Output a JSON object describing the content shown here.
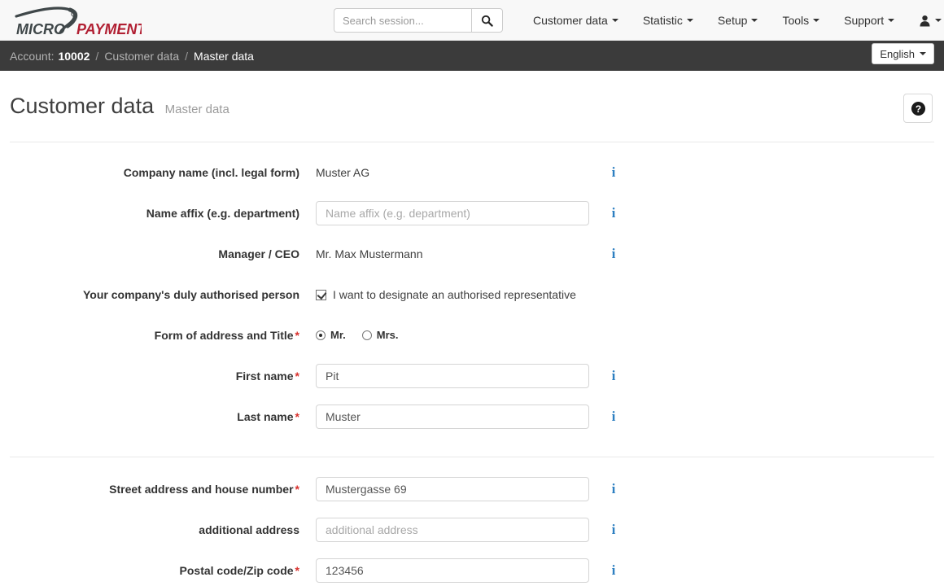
{
  "brand": {
    "word1": "MICRO",
    "word2": "PAYMENT",
    "color1": "#3f4749",
    "color2": "#b12033"
  },
  "search": {
    "placeholder": "Search session...",
    "value": "",
    "icon": "search-icon"
  },
  "nav": {
    "items": [
      {
        "label": "Customer data",
        "caret": true
      },
      {
        "label": "Statistic",
        "caret": true
      },
      {
        "label": "Setup",
        "caret": true
      },
      {
        "label": "Tools",
        "caret": true
      },
      {
        "label": "Support",
        "caret": true
      }
    ],
    "user_menu": {
      "icon": "user-icon",
      "caret": true
    }
  },
  "breadcrumb": {
    "account_label": "Account:",
    "account_number": "10002",
    "sep": "/",
    "item2": "Customer data",
    "item3": "Master data",
    "language": {
      "label": "English",
      "caret": true
    }
  },
  "page": {
    "title": "Customer data",
    "subtitle": "Master data",
    "help_icon": "question-mark-icon"
  },
  "form": {
    "required_marker": "*",
    "info_icon": "info-icon",
    "section1": [
      {
        "label": "Company name (incl. legal form)",
        "type": "static",
        "value": "Muster AG",
        "required": false,
        "info": true
      },
      {
        "label": "Name affix (e.g. department)",
        "type": "input",
        "value": "",
        "placeholder": "Name affix (e.g. department)",
        "required": false,
        "info": true
      },
      {
        "label": "Manager / CEO",
        "type": "static",
        "value": "Mr. Max Mustermann",
        "required": false,
        "info": true
      },
      {
        "label": "Your company's duly authorised person",
        "type": "checkbox",
        "checkbox_label": "I want to designate an authorised representative",
        "checked": true,
        "required": false,
        "info": false
      },
      {
        "label": "Form of address and Title",
        "type": "radio",
        "required": true,
        "options": [
          {
            "label": "Mr.",
            "selected": true
          },
          {
            "label": "Mrs.",
            "selected": false
          }
        ],
        "info": false
      },
      {
        "label": "First name",
        "type": "input",
        "value": "Pit",
        "placeholder": "",
        "required": true,
        "info": true
      },
      {
        "label": "Last name",
        "type": "input",
        "value": "Muster",
        "placeholder": "",
        "required": true,
        "info": true
      }
    ],
    "section2": [
      {
        "label": "Street address and house number",
        "type": "input",
        "value": "Mustergasse 69",
        "placeholder": "",
        "required": true,
        "info": true
      },
      {
        "label": "additional address",
        "type": "input",
        "value": "",
        "placeholder": "additional address",
        "required": false,
        "info": true
      },
      {
        "label": "Postal code/Zip code",
        "type": "input",
        "value": "123456",
        "placeholder": "",
        "required": true,
        "info": true
      }
    ]
  },
  "colors": {
    "accent_red": "#b12033",
    "info_blue": "#2d7fc1",
    "crumbbar": "#3b3b3b",
    "required": "#d9322e"
  }
}
